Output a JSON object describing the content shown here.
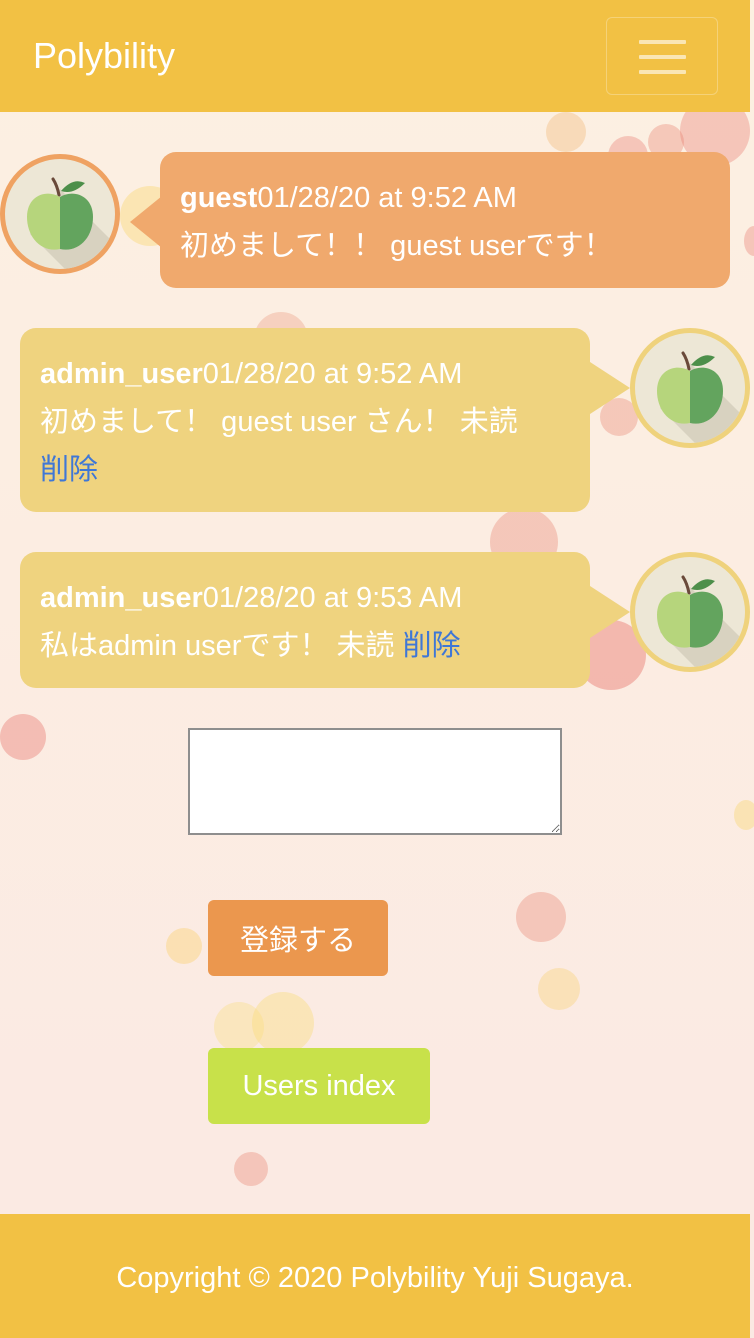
{
  "navbar": {
    "brand": "Polybility",
    "toggle_icon": "hamburger-icon"
  },
  "messages": [
    {
      "name": "guest",
      "timestamp": "01/28/20 at 9:52 AM",
      "text": "初めまして！！ guest userです！",
      "unread": "",
      "delete": "",
      "avatar_icon": "green-apple-icon",
      "side": "left"
    },
    {
      "name": "admin_user",
      "timestamp": "01/28/20 at 9:52 AM",
      "text": "初めまして！ guest user さん！",
      "unread": "未読",
      "delete": "削除",
      "avatar_icon": "green-apple-icon",
      "side": "right"
    },
    {
      "name": "admin_user",
      "timestamp": "01/28/20 at 9:53 AM",
      "text": "私はadmin userです！",
      "unread": "未読",
      "delete": "削除",
      "avatar_icon": "green-apple-icon",
      "side": "right"
    }
  ],
  "form": {
    "message_value": "",
    "submit_label": "登録する"
  },
  "users_index_label": "Users index",
  "footer": {
    "copyright": "Copyright © 2020 Polybility Yuji Sugaya."
  },
  "colors": {
    "header": "#f2c144",
    "guest_bubble": "#f0a96d",
    "admin_bubble": "#efd37f",
    "submit_button": "#eb974e",
    "users_button": "#c8e14a",
    "link": "#3f77d6"
  }
}
